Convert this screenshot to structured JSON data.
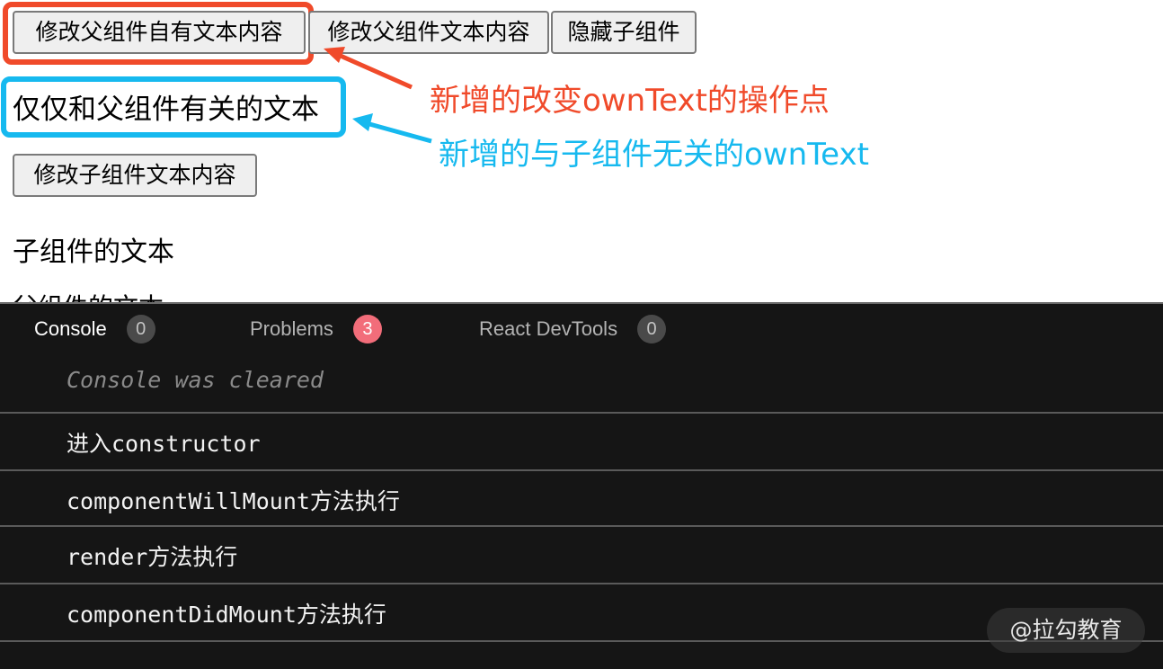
{
  "app": {
    "buttons": {
      "edit_parent_own_text": "修改父组件自有文本内容",
      "edit_parent_text": "修改父组件文本内容",
      "hide_child": "隐藏子组件",
      "edit_child_text": "修改子组件文本内容"
    },
    "own_text": "仅仅和父组件有关的文本",
    "child_text": "子组件的文本",
    "cut_text": "父组件的文本"
  },
  "annotations": {
    "red": "新增的改变ownText的操作点",
    "blue": "新增的与子组件无关的ownText",
    "colors": {
      "red": "#f04a2a",
      "blue": "#16b9ef"
    }
  },
  "console": {
    "tabs": [
      {
        "label": "Console",
        "count": "0"
      },
      {
        "label": "Problems",
        "count": "3"
      },
      {
        "label": "React DevTools",
        "count": "0"
      }
    ],
    "cleared_message": "Console was cleared",
    "logs": [
      "进入constructor",
      "componentWillMount方法执行",
      "render方法执行",
      "componentDidMount方法执行"
    ]
  },
  "watermark": "@拉勾教育"
}
